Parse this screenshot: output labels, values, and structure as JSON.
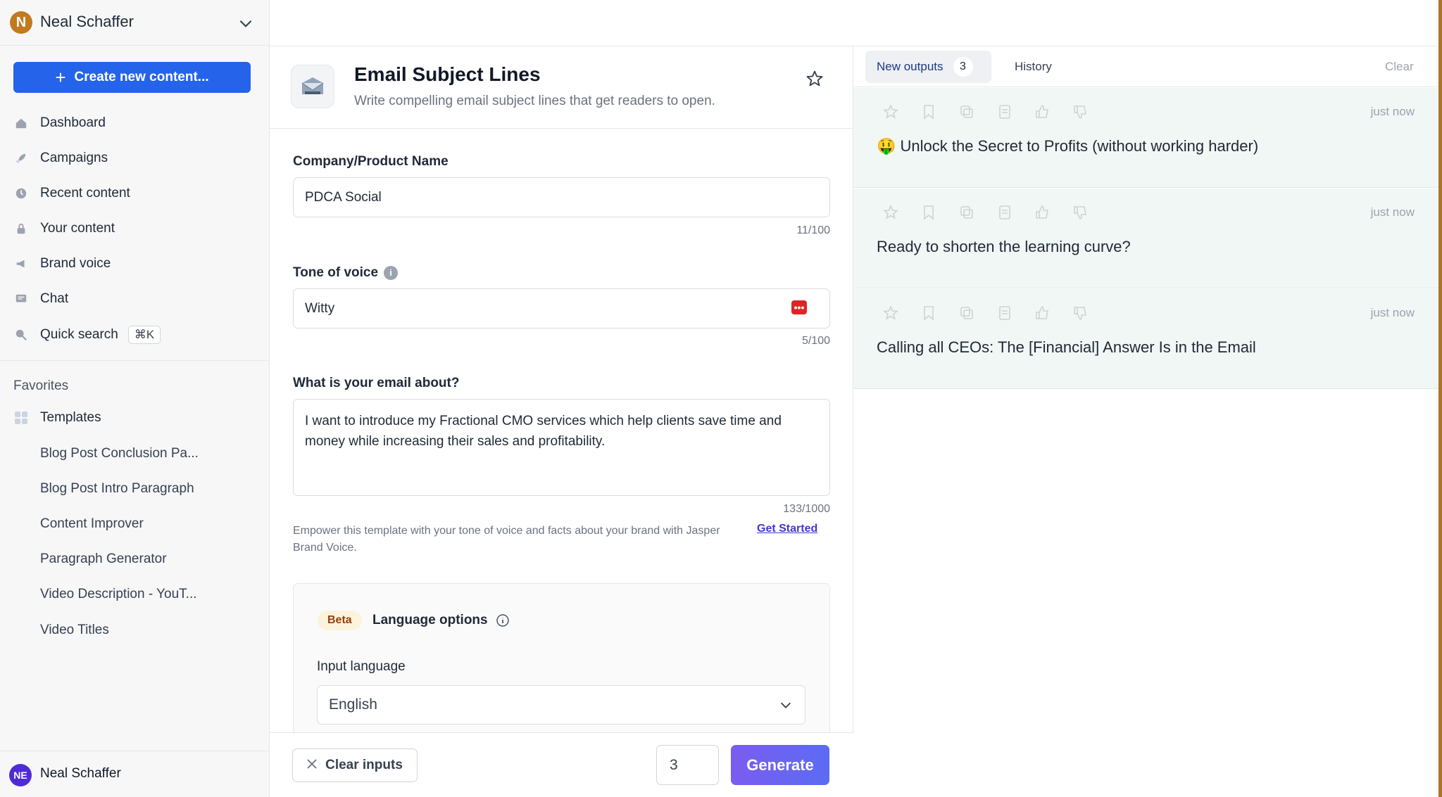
{
  "account": {
    "initial": "N",
    "name": "Neal Schaffer",
    "bottom_initials": "NE",
    "bottom_name": "Neal Schaffer"
  },
  "sidebar": {
    "create_label": "Create new content...",
    "nav": [
      {
        "label": "Dashboard",
        "icon": "home-icon"
      },
      {
        "label": "Campaigns",
        "icon": "rocket-icon"
      },
      {
        "label": "Recent content",
        "icon": "clock-icon"
      },
      {
        "label": "Your content",
        "icon": "lock-icon"
      },
      {
        "label": "Brand voice",
        "icon": "megaphone-icon"
      },
      {
        "label": "Chat",
        "icon": "chat-icon"
      },
      {
        "label": "Quick search",
        "icon": "search-icon",
        "shortcut": "⌘K"
      }
    ],
    "favorites_heading": "Favorites",
    "templates_label": "Templates",
    "templates": [
      "Blog Post Conclusion Pa...",
      "Blog Post Intro Paragraph",
      "Content Improver",
      "Paragraph Generator",
      "Video Description - YouT...",
      "Video Titles"
    ]
  },
  "template": {
    "title": "Email Subject Lines",
    "description": "Write compelling email subject lines that get readers to open."
  },
  "form": {
    "company_label": "Company/Product Name",
    "company_value": "PDCA Social",
    "company_counter": "11/100",
    "tone_label": "Tone of voice",
    "tone_value": "Witty",
    "tone_counter": "5/100",
    "about_label": "What is your email about?",
    "about_value": "I want to introduce my Fractional CMO services which help clients save time and money while increasing their sales and profitability.",
    "about_counter": "133/1000",
    "brand_note": "Empower this template with your tone of voice and facts about your brand with Jasper Brand Voice.",
    "get_started": "Get Started",
    "beta": "Beta",
    "language_title": "Language options",
    "input_language_label": "Input language",
    "input_language_value": "English",
    "clear_inputs": "Clear inputs",
    "quantity": "3",
    "generate": "Generate"
  },
  "outputs": {
    "tab_new": "New outputs",
    "tab_new_count": "3",
    "tab_history": "History",
    "clear": "Clear",
    "items": [
      {
        "time": "just now",
        "text": "🤑 Unlock the Secret to Profits (without working harder)"
      },
      {
        "time": "just now",
        "text": "Ready to shorten the learning curve?"
      },
      {
        "time": "just now",
        "text": "Calling all CEOs: The [Financial] Answer Is in the Email"
      }
    ]
  },
  "colors": {
    "primary": "#2563eb",
    "generate_start": "#7c5cf0",
    "generate_end": "#5b6cf2",
    "output_bg": "#f1f7f5"
  }
}
